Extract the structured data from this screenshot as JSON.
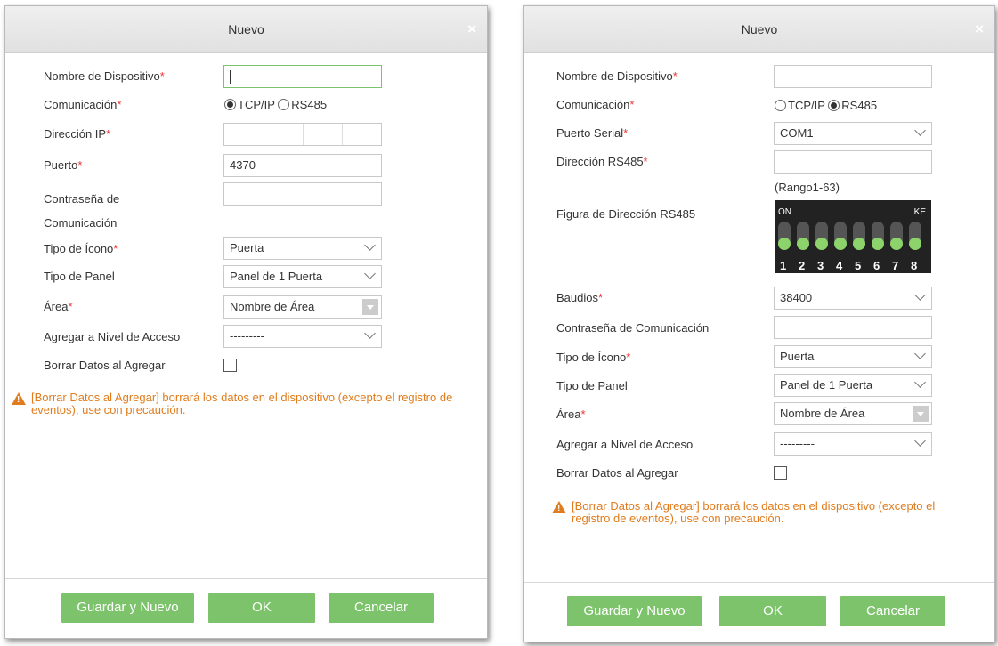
{
  "dialog1": {
    "title": "Nuevo",
    "close_glyph": "×",
    "device_name": {
      "label": "Nombre de Dispositivo",
      "value": ""
    },
    "communication": {
      "label": "Comunicación",
      "options": [
        "TCP/IP",
        "RS485"
      ],
      "selected": "TCP/IP"
    },
    "ip_address": {
      "label": "Dirección IP"
    },
    "port": {
      "label": "Puerto",
      "value": "4370"
    },
    "comm_password": {
      "label_line1": "Contraseña de",
      "label_line2": "Comunicación",
      "value": ""
    },
    "icon_type": {
      "label": "Tipo de Ícono",
      "value": "Puerta"
    },
    "panel_type": {
      "label": "Tipo de Panel",
      "value": "Panel de 1 Puerta"
    },
    "area": {
      "label": "Área",
      "value": "Nombre de Área"
    },
    "access_level": {
      "label": "Agregar a Nivel de Acceso",
      "value": "---------"
    },
    "clear_data": {
      "label": "Borrar Datos al Agregar",
      "checked": false
    },
    "warning": "[Borrar Datos al Agregar] borrará los datos en el dispositivo (excepto el registro de eventos), use con precaución.",
    "buttons": {
      "save_new": "Guardar y Nuevo",
      "ok": "OK",
      "cancel": "Cancelar"
    }
  },
  "dialog2": {
    "title": "Nuevo",
    "close_glyph": "×",
    "device_name": {
      "label": "Nombre de Dispositivo",
      "value": ""
    },
    "communication": {
      "label": "Comunicación",
      "options": [
        "TCP/IP",
        "RS485"
      ],
      "selected": "RS485"
    },
    "serial_port": {
      "label": "Puerto Serial",
      "value": "COM1"
    },
    "rs485_address": {
      "label": "Dirección RS485",
      "value": "",
      "hint": "(Rango1-63)"
    },
    "rs485_figure": {
      "label": "Figura de Dirección RS485",
      "on_text": "ON",
      "ke_text": "KE",
      "switch_numbers": [
        "1",
        "2",
        "3",
        "4",
        "5",
        "6",
        "7",
        "8"
      ]
    },
    "baud": {
      "label": "Baudios",
      "value": "38400"
    },
    "comm_password": {
      "label": "Contraseña de Comunicación",
      "value": ""
    },
    "icon_type": {
      "label": "Tipo de Ícono",
      "value": "Puerta"
    },
    "panel_type": {
      "label": "Tipo de Panel",
      "value": "Panel de 1 Puerta"
    },
    "area": {
      "label": "Área",
      "value": "Nombre de Área"
    },
    "access_level": {
      "label": "Agregar a Nivel de Acceso",
      "value": "---------"
    },
    "clear_data": {
      "label": "Borrar Datos al Agregar",
      "checked": false
    },
    "warning": "[Borrar Datos al Agregar] borrará los datos en el dispositivo (excepto el registro de eventos), use con precaución.",
    "buttons": {
      "save_new": "Guardar y Nuevo",
      "ok": "OK",
      "cancel": "Cancelar"
    }
  },
  "required_marker": "*",
  "colors": {
    "accent_green": "#7cc36b",
    "warning_orange": "#e07c1e",
    "required_red": "#e33"
  }
}
